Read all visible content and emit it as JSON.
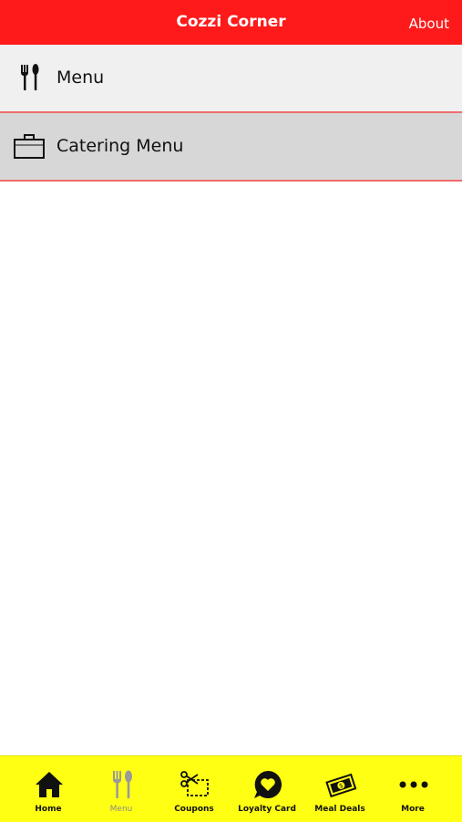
{
  "header": {
    "title": "Cozzi Corner",
    "about_label": "About"
  },
  "list": [
    {
      "label": "Menu",
      "icon": "fork-spoon-icon"
    },
    {
      "label": "Catering Menu",
      "icon": "bag-icon"
    }
  ],
  "tabbar": {
    "tabs": [
      {
        "label": "Home",
        "icon": "home-icon",
        "active": false
      },
      {
        "label": "Menu",
        "icon": "fork-spoon-icon",
        "active": true
      },
      {
        "label": "Coupons",
        "icon": "coupon-scissors-icon",
        "active": false
      },
      {
        "label": "Loyalty Card",
        "icon": "heart-bubble-icon",
        "active": false
      },
      {
        "label": "Meal Deals",
        "icon": "money-icon",
        "active": false
      },
      {
        "label": "More",
        "icon": "more-dots-icon",
        "active": false
      }
    ]
  },
  "colors": {
    "header_bg": "#fe1a1a",
    "tabbar_bg": "#ffff14",
    "row_divider": "#f06c6c"
  }
}
